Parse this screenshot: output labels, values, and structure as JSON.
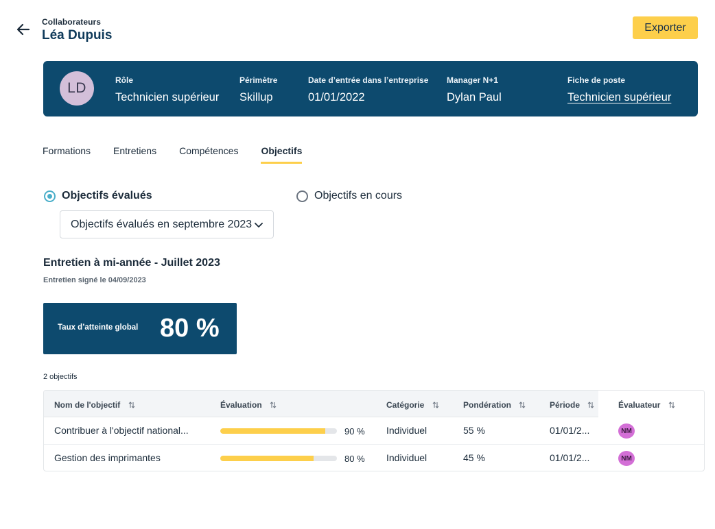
{
  "header": {
    "breadcrumb": "Collaborateurs",
    "title": "Léa Dupuis",
    "export_label": "Exporter"
  },
  "profile": {
    "initials": "LD",
    "fields": [
      {
        "label": "Rôle",
        "value": "Technicien supérieur"
      },
      {
        "label": "Périmètre",
        "value": "Skillup"
      },
      {
        "label": "Date d’entrée dans l’entreprise",
        "value": "01/01/2022"
      },
      {
        "label": "Manager N+1",
        "value": "Dylan Paul"
      },
      {
        "label": "Fiche de poste",
        "value": "Technicien supérieur"
      }
    ]
  },
  "tabs": [
    {
      "label": "Formations",
      "active": false
    },
    {
      "label": "Entretiens",
      "active": false
    },
    {
      "label": "Compétences",
      "active": false
    },
    {
      "label": "Objectifs",
      "active": true
    }
  ],
  "filters": {
    "evaluated_label": "Objectifs évalués",
    "evaluated_checked": true,
    "in_progress_label": "Objectifs en cours",
    "in_progress_checked": false,
    "select_value": "Objectifs évalués en septembre 2023"
  },
  "interview": {
    "title": "Entretien à mi-année - Juillet 2023",
    "signed": "Entretien signé le 04/09/2023"
  },
  "score": {
    "label": "Taux d’atteinte global",
    "value": "80 %"
  },
  "objectives_count": "2 objectifs",
  "table": {
    "columns": [
      "Nom de l'objectif",
      "Évaluation",
      "Catégorie",
      "Pondération",
      "Période",
      "Évaluateur"
    ],
    "rows": [
      {
        "name": "Contribuer à l'objectif national...",
        "evaluation": 90,
        "evaluation_label": "90 %",
        "category": "Individuel",
        "weight": "55 %",
        "period": "01/01/2...",
        "evaluator": "NM"
      },
      {
        "name": "Gestion des imprimantes",
        "evaluation": 80,
        "evaluation_label": "80 %",
        "category": "Individuel",
        "weight": "45 %",
        "period": "01/01/2...",
        "evaluator": "NM"
      }
    ]
  },
  "colors": {
    "primary": "#0d4a6e",
    "accent": "#fdcf4b",
    "radio": "#4aaec9",
    "evaluator_avatar": "#d36fd6"
  }
}
